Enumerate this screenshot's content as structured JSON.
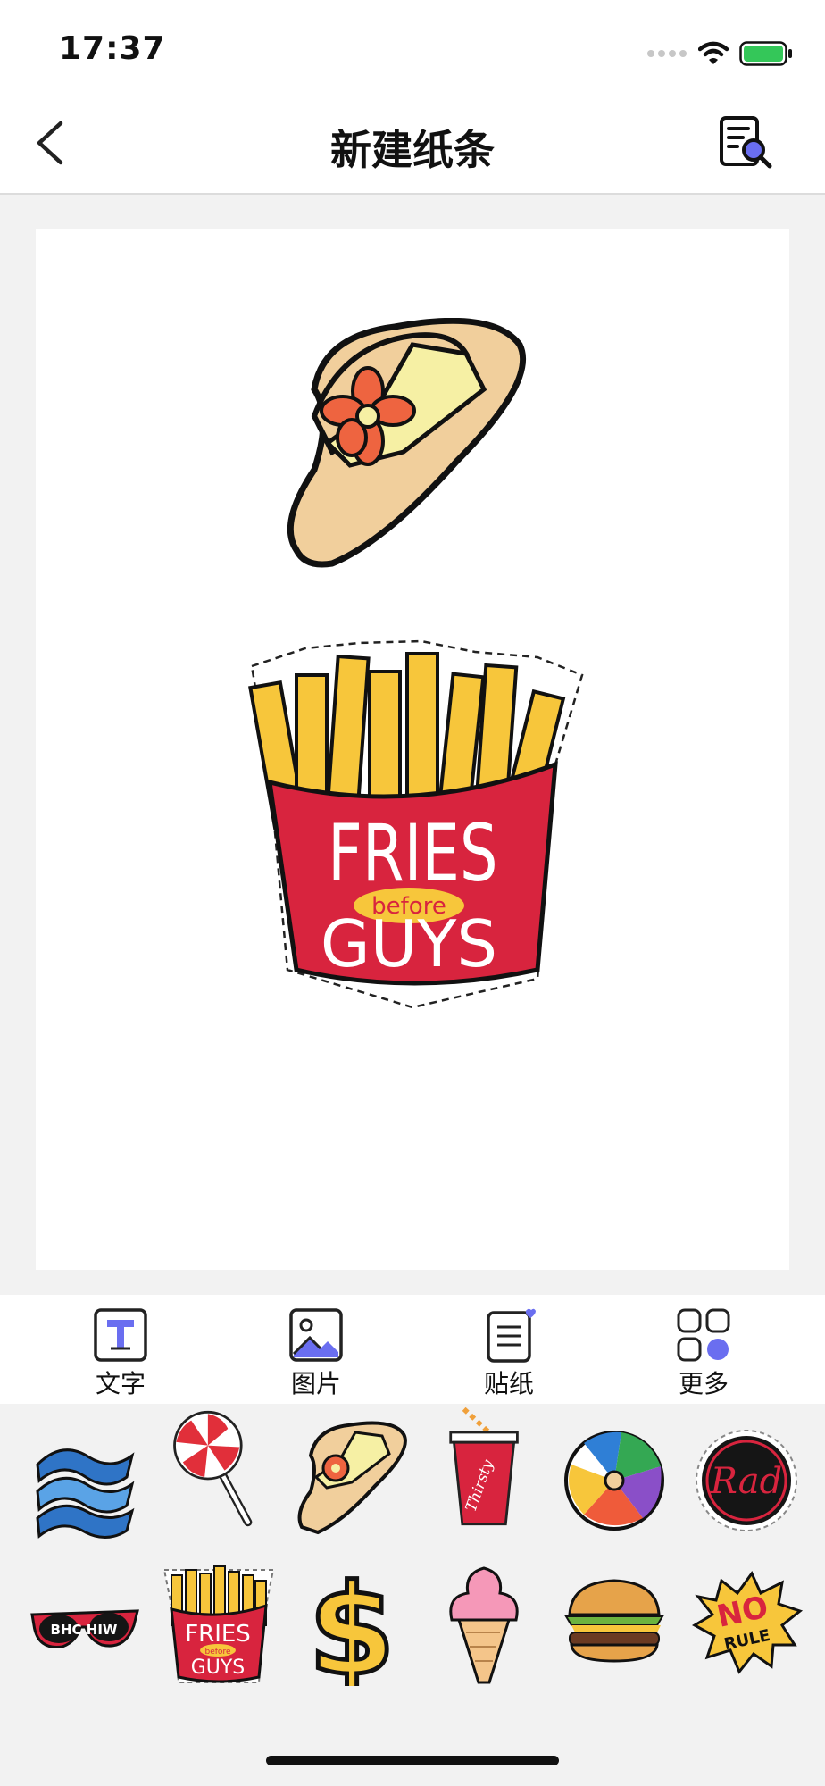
{
  "status": {
    "time": "17:37"
  },
  "nav": {
    "title": "新建纸条",
    "back_icon": "chevron-left-icon",
    "action_icon": "document-search-icon"
  },
  "canvas": {
    "stickers": [
      {
        "name": "sun-hat",
        "icon": "hat-sticker"
      },
      {
        "name": "fries-before-guys",
        "icon": "fries-sticker",
        "text_top": "FRIES",
        "text_mid": "before",
        "text_bottom": "GUYS"
      }
    ]
  },
  "toolbar": {
    "items": [
      {
        "label": "文字",
        "icon": "text-icon"
      },
      {
        "label": "图片",
        "icon": "image-icon"
      },
      {
        "label": "贴纸",
        "icon": "sticker-note-icon"
      },
      {
        "label": "更多",
        "icon": "grid-more-icon"
      }
    ]
  },
  "tray": {
    "stickers": [
      {
        "icon": "waves-sticker"
      },
      {
        "icon": "lollipop-sticker"
      },
      {
        "icon": "hat-sticker"
      },
      {
        "icon": "cup-sticker",
        "text": "Thirsty"
      },
      {
        "icon": "beach-ball-sticker"
      },
      {
        "icon": "rad-badge-sticker",
        "text": "Rad"
      },
      {
        "icon": "sunglasses-sticker",
        "text": "BHC HIW"
      },
      {
        "icon": "fries-sticker",
        "text_top": "FRIES",
        "text_mid": "before",
        "text_bottom": "GUYS"
      },
      {
        "icon": "dollar-sticker",
        "text": "$"
      },
      {
        "icon": "ice-cream-sticker"
      },
      {
        "icon": "burger-sticker"
      },
      {
        "icon": "no-rule-sticker",
        "text_top": "NO",
        "text_bottom": "RULE"
      }
    ]
  },
  "colors": {
    "accent_blue": "#6a6ef0",
    "battery_green": "#34c759",
    "fries_red": "#d8243e",
    "fries_yellow": "#f7c63b",
    "hat_tan": "#f1cf9c"
  }
}
